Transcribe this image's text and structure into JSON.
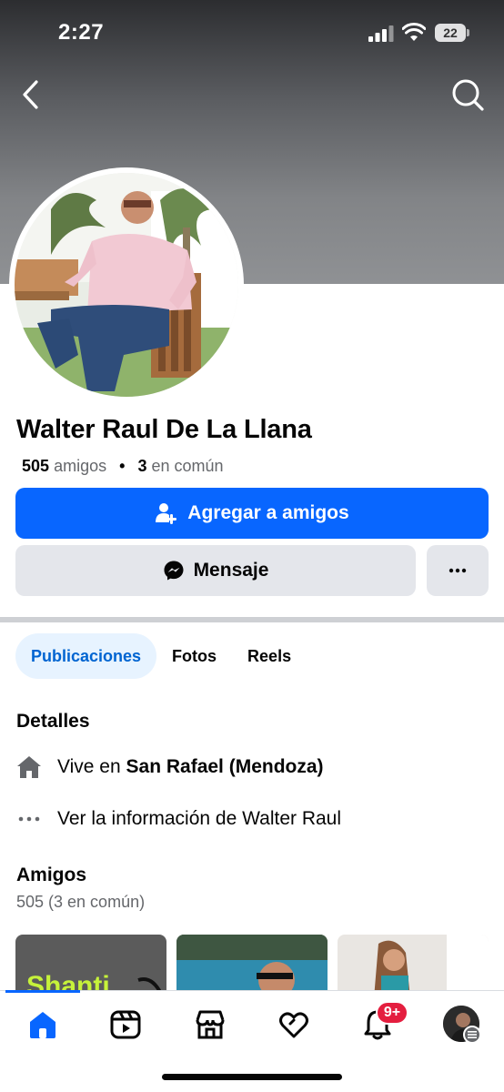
{
  "status_bar": {
    "time": "2:27",
    "battery": "22"
  },
  "profile": {
    "name": "Walter Raul De La Llana",
    "friends_count": "505",
    "friends_word": "amigos",
    "mutual_count": "3",
    "mutual_word": "en común"
  },
  "actions": {
    "add_friend": "Agregar a amigos",
    "message": "Mensaje"
  },
  "tabs": [
    {
      "label": "Publicaciones",
      "active": true
    },
    {
      "label": "Fotos",
      "active": false
    },
    {
      "label": "Reels",
      "active": false
    }
  ],
  "details": {
    "title": "Detalles",
    "lives_prefix": "Vive en",
    "lives_place": "San Rafael (Mendoza)",
    "see_info": "Ver la información de Walter Raul"
  },
  "friends_section": {
    "title": "Amigos",
    "summary": "505 (3 en común)",
    "card1_text": "Shanti"
  },
  "bottom_nav": {
    "items": [
      "home-icon",
      "video-icon",
      "marketplace-icon",
      "dating-icon",
      "notifications-icon",
      "profile-icon"
    ],
    "notification_badge": "9+"
  },
  "colors": {
    "brand": "#0866ff",
    "active_tab_bg": "#e7f3ff",
    "badge": "#e41e3f"
  }
}
